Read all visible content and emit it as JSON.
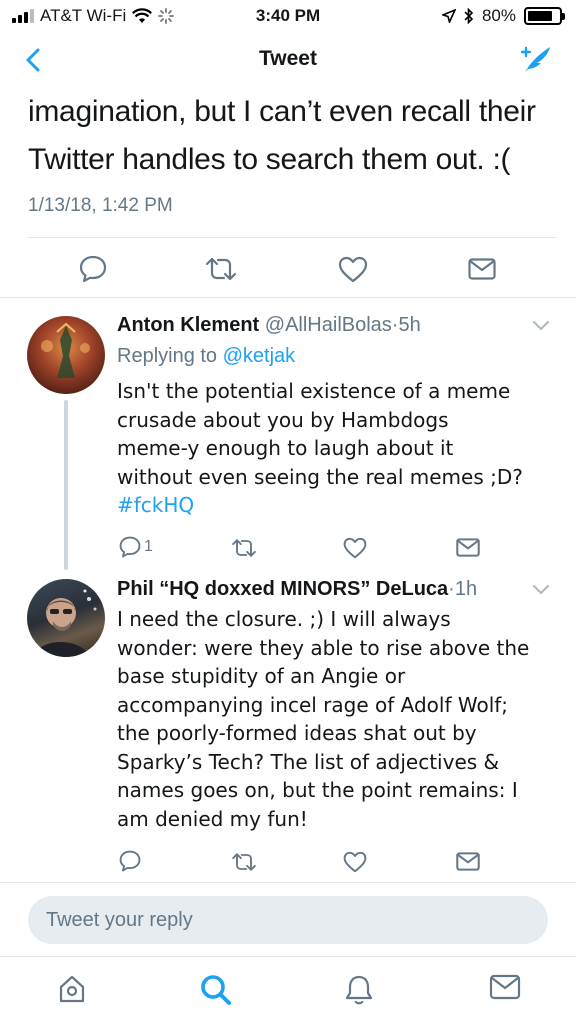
{
  "status_bar": {
    "carrier": "AT&T Wi-Fi",
    "time": "3:40 PM",
    "battery": "80%",
    "battery_level": 0.8
  },
  "nav": {
    "title": "Tweet",
    "back_icon": "chevron-left-icon",
    "compose_icon": "compose-tweet-icon"
  },
  "main_tweet": {
    "text_line1": "imagination, but I can’t even recall their",
    "text_line2": "Twitter handles to search them out. :(",
    "timestamp": "1/13/18, 1:42 PM"
  },
  "replies": [
    {
      "name": "Anton Klement",
      "handle": "@AllHailBolas",
      "time": "5h",
      "replying_to_label": "Replying to",
      "replying_to": "@ketjak",
      "text_lines": [
        "Isn't the potential existence of a meme",
        "crusade  about you by Hambdogs",
        "meme-y enough to laugh about it",
        "without even seeing the real memes ;D?"
      ],
      "hashtag": "#fckHQ",
      "reply_count": "1"
    },
    {
      "name": "Phil “HQ doxxed MINORS” DeLuca",
      "handle": "",
      "time": "1h",
      "text_lines": [
        "I need the closure. ;) I will always",
        "wonder: were they able to rise above the",
        "base stupidity of an Angie or",
        "accompanying incel rage of Adolf Wolf;",
        "the poorly-formed ideas shat out by",
        "Sparky’s Tech? The list of adjectives &",
        "names goes on, but the point remains: I",
        "am denied my fun!"
      ]
    }
  ],
  "reply_bar": {
    "placeholder": "Tweet your reply"
  },
  "tab_bar": {
    "items": [
      "home-icon",
      "search-icon",
      "notifications-icon",
      "messages-icon"
    ]
  },
  "colors": {
    "accent": "#1da1f2",
    "secondary_text": "#657786",
    "divider": "#e1e8ed"
  }
}
